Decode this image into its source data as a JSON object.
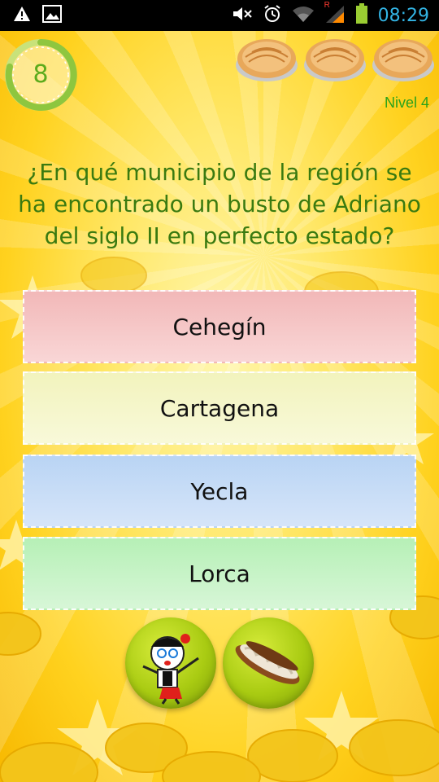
{
  "status_bar": {
    "time": "08:29",
    "signal_badge": "R",
    "left_icons": [
      "warning-icon",
      "image-icon"
    ],
    "right_icons": [
      "mute-icon",
      "alarm-icon",
      "wifi-icon",
      "signal-icon",
      "battery-icon"
    ]
  },
  "game": {
    "timer_value": "8",
    "lives": [
      {
        "icon": "pie-icon"
      },
      {
        "icon": "pie-icon"
      },
      {
        "icon": "pie-icon"
      }
    ],
    "level_label": "Nivel 4",
    "question_lines": [
      "¿En qué municipio de la región se",
      "ha encontrado un busto de Adriano",
      "del siglo II en perfecto estado?"
    ],
    "answers": [
      "Cehegín",
      "Cartagena",
      "Yecla",
      "Lorca"
    ],
    "helpers": [
      {
        "icon": "mascot-helper-icon"
      },
      {
        "icon": "pastry-helper-icon"
      }
    ]
  },
  "colors": {
    "accent_green": "#5cab1c",
    "question_text": "#3a7a10",
    "clock_blue": "#33b5e5",
    "answer_red": "#f2b8b8",
    "answer_yellow": "#f2f3bd",
    "answer_blue": "#b9d4f4",
    "answer_green": "#b6f0b6"
  }
}
